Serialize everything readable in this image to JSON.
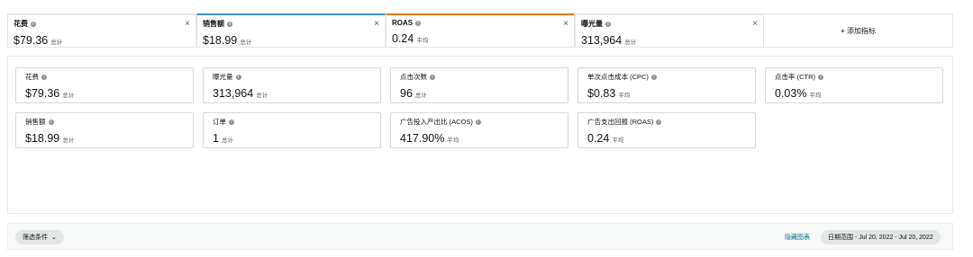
{
  "metrics": [
    {
      "label": "花费",
      "value": "$79.36",
      "suffix": "总计",
      "color": "#e3e6e6"
    },
    {
      "label": "销售额",
      "value": "$18.99",
      "suffix": "总计",
      "color": "#3a8fd3"
    },
    {
      "label": "ROAS",
      "value": "0.24",
      "suffix": "平均",
      "color": "#e07b13"
    },
    {
      "label": "曝光量",
      "value": "313,964",
      "suffix": "总计",
      "color": "#e3e6e6"
    }
  ],
  "close_glyph": "×",
  "add_metric_label": "+ 添加指标",
  "selector": [
    {
      "label": "花费",
      "value": "$79.36",
      "suffix": "总计",
      "active": false
    },
    {
      "label": "曝光量",
      "value": "313,964",
      "suffix": "总计",
      "active": false
    },
    {
      "label": "点击次数",
      "value": "96",
      "suffix": "总计",
      "active": true
    },
    {
      "label": "单次点击成本 (CPC)",
      "value": "$0.83",
      "suffix": "平均",
      "active": true
    },
    {
      "label": "点击率 (CTR)",
      "value": "0.03%",
      "suffix": "平均",
      "active": true
    },
    {
      "label": "销售额",
      "value": "$18.99",
      "suffix": "总计",
      "active": false
    },
    {
      "label": "订单",
      "value": "1",
      "suffix": "总计",
      "active": true
    },
    {
      "label": "广告投入产出比 (ACOS)",
      "value": "417.90%",
      "suffix": "平均",
      "active": true
    },
    {
      "label": "广告支出回报 (ROAS)",
      "value": "0.24",
      "suffix": "平均",
      "active": false
    }
  ],
  "filter": {
    "label": "筛选条件",
    "chevron": "⌄"
  },
  "hide_chart_label": "隐藏图表",
  "date_range_label": "日期范围 - Jul 20, 2022 - Jul 20, 2022",
  "info_glyph": "i"
}
